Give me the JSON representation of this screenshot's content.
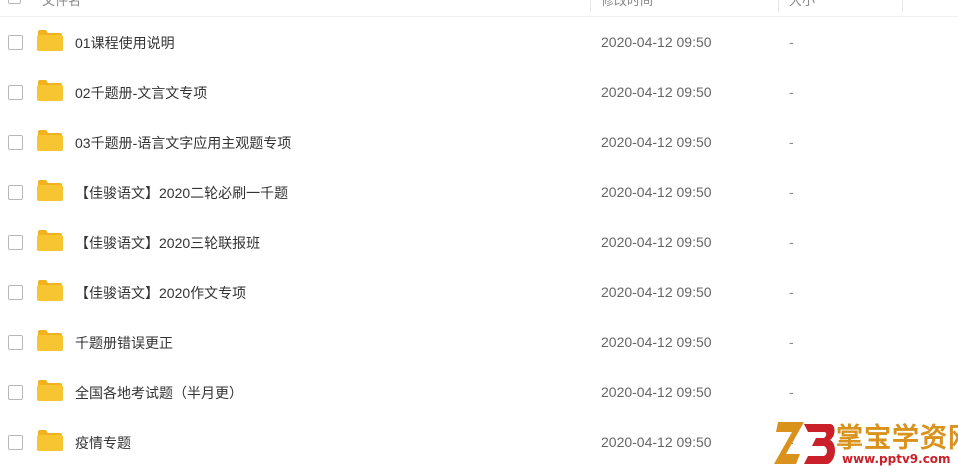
{
  "header": {
    "name_label": "文件名",
    "modified_label": "修改时间",
    "size_label": "大小",
    "sort_indicator": "↓"
  },
  "files": [
    {
      "name": "01课程使用说明",
      "modified": "2020-04-12 09:50",
      "size": "-"
    },
    {
      "name": "02千题册-文言文专项",
      "modified": "2020-04-12 09:50",
      "size": "-"
    },
    {
      "name": "03千题册-语言文字应用主观题专项",
      "modified": "2020-04-12 09:50",
      "size": "-"
    },
    {
      "name": "【佳骏语文】2020二轮必刷一千题",
      "modified": "2020-04-12 09:50",
      "size": "-"
    },
    {
      "name": "【佳骏语文】2020三轮联报班",
      "modified": "2020-04-12 09:50",
      "size": "-"
    },
    {
      "name": "【佳骏语文】2020作文专项",
      "modified": "2020-04-12 09:50",
      "size": "-"
    },
    {
      "name": "千题册错误更正",
      "modified": "2020-04-12 09:50",
      "size": "-"
    },
    {
      "name": "全国各地考试题（半月更）",
      "modified": "2020-04-12 09:50",
      "size": "-"
    },
    {
      "name": "疫情专题",
      "modified": "2020-04-12 09:50",
      "size": "-"
    }
  ],
  "watermark": {
    "title": "掌宝学资网",
    "url": "www.pptv9.com"
  },
  "colors": {
    "folder": "#f8c532",
    "folder_tab": "#f0b31f",
    "watermark_title": "#d9921c",
    "watermark_url": "#c9202a",
    "sort_arrow": "#3b8cff"
  }
}
